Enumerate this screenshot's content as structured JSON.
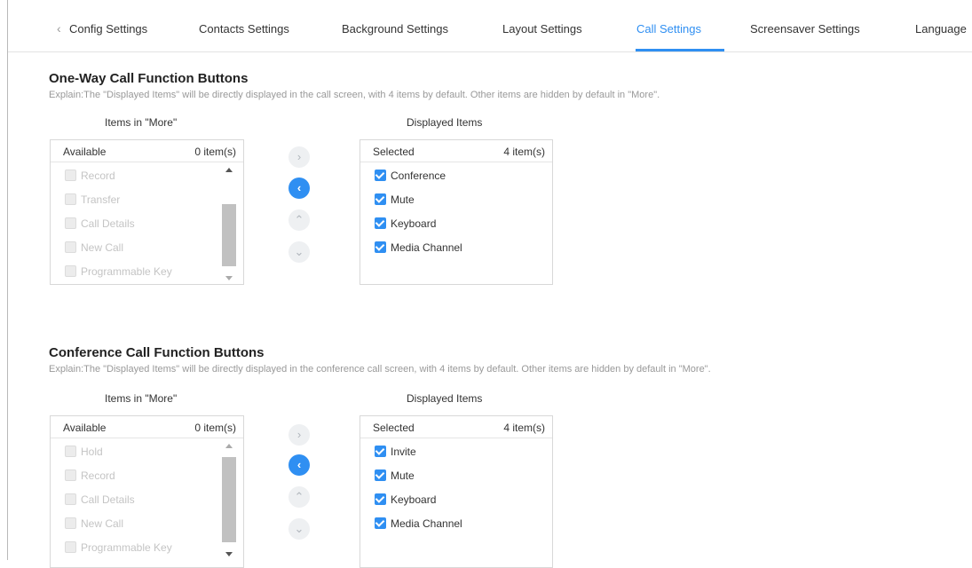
{
  "tabs": [
    {
      "label": "Config Settings"
    },
    {
      "label": "Contacts Settings"
    },
    {
      "label": "Background Settings"
    },
    {
      "label": "Layout Settings"
    },
    {
      "label": "Call Settings",
      "active": true
    },
    {
      "label": "Screensaver Settings"
    },
    {
      "label": "Language"
    }
  ],
  "tab_back_glyph": "‹",
  "accent_color": "#2f8ff2",
  "one_way": {
    "title": "One-Way Call Function Buttons",
    "explain": "Explain:The \"Displayed Items\" will be directly displayed in the call screen, with 4 items by default. Other items are hidden by default in \"More\".",
    "more_header": "Items in \"More\"",
    "displayed_header": "Displayed Items",
    "available_label": "Available",
    "available_count": "0 item(s)",
    "available_items": [
      "Record",
      "Transfer",
      "Call Details",
      "New Call",
      "Programmable Key"
    ],
    "selected_label": "Selected",
    "selected_count": "4 item(s)",
    "selected_items": [
      "Conference",
      "Mute",
      "Keyboard",
      "Media Channel"
    ]
  },
  "conference": {
    "title": "Conference Call Function Buttons",
    "explain": "Explain:The \"Displayed Items\" will be directly displayed in the conference call screen, with 4 items by default. Other items are hidden by default in \"More\".",
    "more_header": "Items in \"More\"",
    "displayed_header": "Displayed Items",
    "available_label": "Available",
    "available_count": "0 item(s)",
    "available_items": [
      "Hold",
      "Record",
      "Call Details",
      "New Call",
      "Programmable Key"
    ],
    "selected_label": "Selected",
    "selected_count": "4 item(s)",
    "selected_items": [
      "Invite",
      "Mute",
      "Keyboard",
      "Media Channel"
    ]
  },
  "move_buttons": {
    "right": "›",
    "left": "‹",
    "up": "⌃",
    "down": "⌄"
  }
}
